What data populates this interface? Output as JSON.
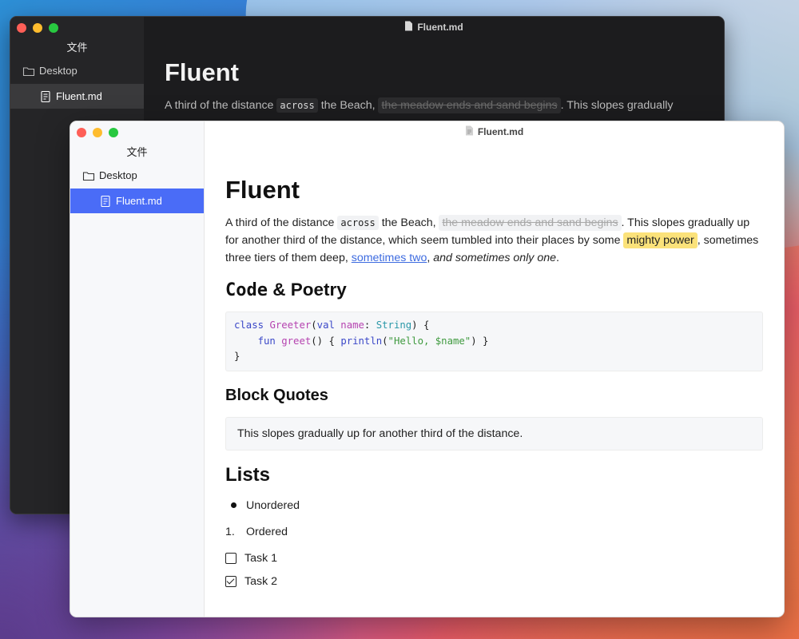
{
  "app": {
    "window_title": "Fluent.md",
    "sidebar_title": "文件",
    "tree": {
      "folder": "Desktop",
      "file": "Fluent.md"
    }
  },
  "doc": {
    "title": "Fluent",
    "para": {
      "t1": "A third of the distance ",
      "code": "across",
      "t2": " the Beach, ",
      "strike": "the meadow ends and sand begins",
      "t3": ". This slopes gradually up for another third of the distance, which seem tumbled into their places by some ",
      "mark": "mighty power",
      "t4": ", sometimes three tiers of them deep, ",
      "link": "sometimes two",
      "t5": ", ",
      "em": "and sometimes only one",
      "t6": "."
    },
    "dark_para_visible": "A third of the distance",
    "dark_code": "across",
    "dark_t2": " the Beach, ",
    "dark_strike": "the meadow ends and sand begins",
    "dark_t3": ". This slopes gradually",
    "sec1": {
      "mono": "Code",
      "rest": " & Poetry"
    },
    "code": {
      "l1_kw1": "class",
      "l1_fn": "Greeter",
      "l1_p1": "(",
      "l1_kw2": "val",
      "l1_name": "name",
      "l1_colon": ": ",
      "l1_ty": "String",
      "l1_end": ") {",
      "l2_ind": "    ",
      "l2_kw": "fun",
      "l2_fn": "greet",
      "l2_mid": "() { ",
      "l2_call": "println",
      "l2_p": "(",
      "l2_str": "\"Hello, $name\"",
      "l2_end": ") }",
      "l3": "}"
    },
    "sec2": "Block Quotes",
    "quote": "This slopes gradually up for another third of the distance.",
    "sec3": "Lists",
    "list": {
      "unordered": "Unordered",
      "ordered_num": "1.",
      "ordered": "Ordered",
      "task1": "Task 1",
      "task2": "Task 2"
    }
  },
  "colors": {
    "accent": "#4a6cf7",
    "highlight": "#fbe27a",
    "link": "#3d6be0"
  }
}
